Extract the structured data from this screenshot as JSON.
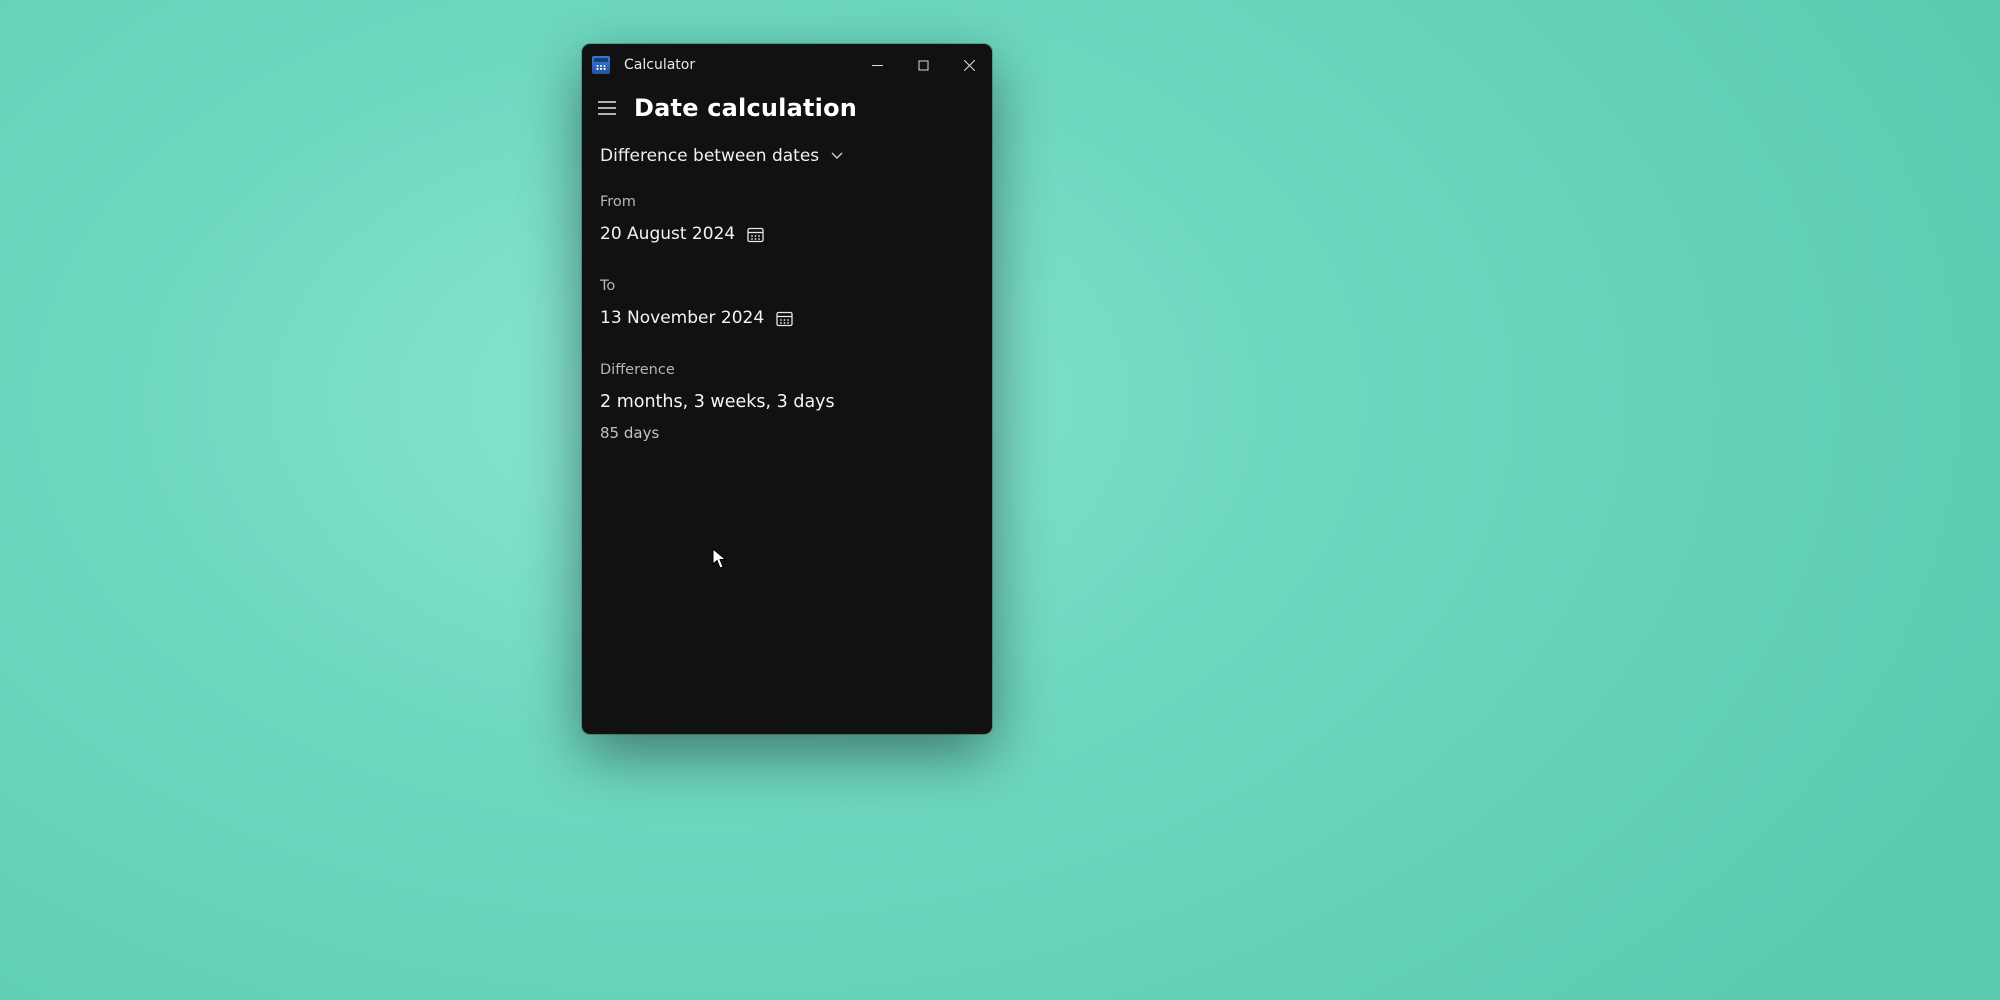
{
  "titlebar": {
    "app_name": "Calculator"
  },
  "header": {
    "page_title": "Date calculation"
  },
  "mode": {
    "selected_label": "Difference between dates"
  },
  "fields": {
    "from": {
      "label": "From",
      "value": "20 August 2024"
    },
    "to": {
      "label": "To",
      "value": "13 November 2024"
    }
  },
  "result": {
    "label": "Difference",
    "primary": "2 months, 3 weeks, 3 days",
    "secondary": "85 days"
  }
}
